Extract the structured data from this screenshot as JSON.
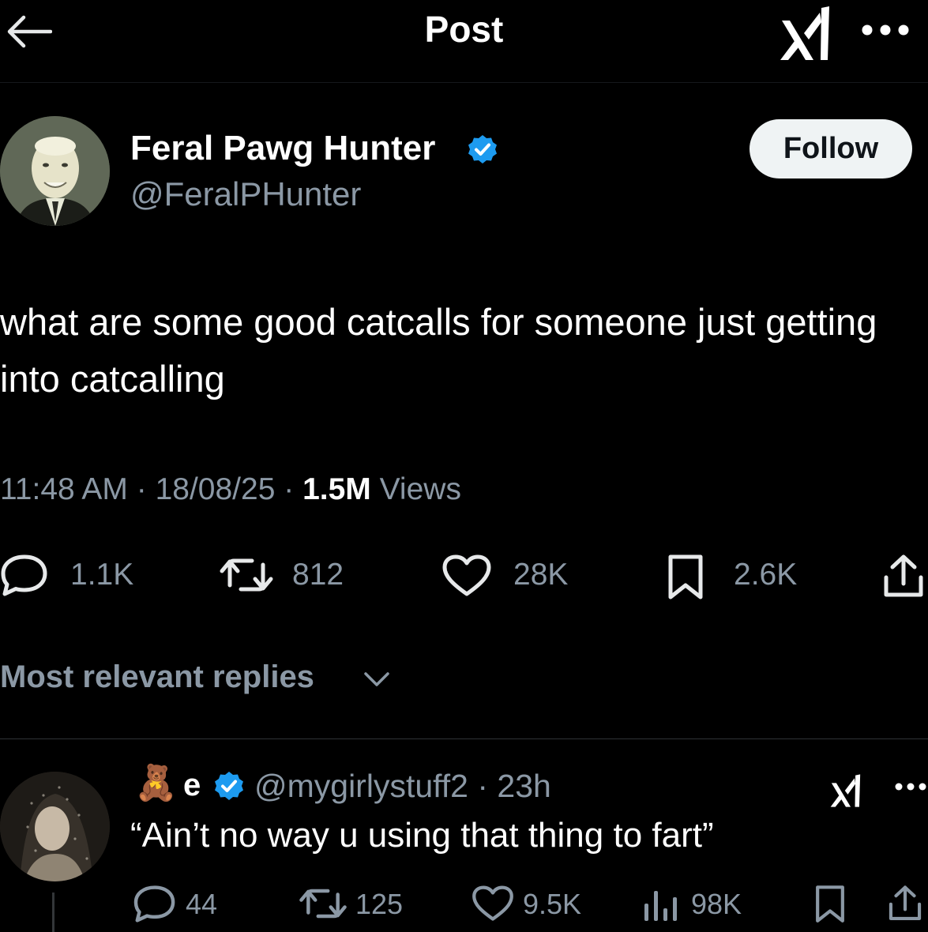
{
  "header": {
    "title": "Post",
    "back_icon": "arrow-left-icon",
    "logo_icon": "xai-logo-icon",
    "more_icon": "more-horizontal-icon"
  },
  "post": {
    "author": {
      "name": "Feral Pawg Hunter",
      "handle": "@FeralPHunter",
      "verified": true
    },
    "follow_label": "Follow",
    "text": "what are some good catcalls for someone just getting into catcalling",
    "time": "11:48 AM",
    "date": "18/08/25",
    "views_count": "1.5M",
    "views_label": "Views",
    "separator": "·",
    "actions": {
      "replies": "1.1K",
      "reposts": "812",
      "likes": "28K",
      "bookmarks": "2.6K"
    }
  },
  "replies_sort": {
    "label": "Most relevant replies"
  },
  "reply": {
    "emoji": "🧸",
    "name": "e",
    "verified": true,
    "handle": "@mygirlystuff2 · 23h",
    "text": "“Ain’t no way u using that thing to fart”",
    "actions": {
      "replies": "44",
      "reposts": "125",
      "likes": "9.5K",
      "views": "98K"
    }
  },
  "colors": {
    "background": "#000000",
    "text_primary": "#e7e9ea",
    "text_secondary": "#8b98a5",
    "verified_blue": "#1d9bf0"
  }
}
